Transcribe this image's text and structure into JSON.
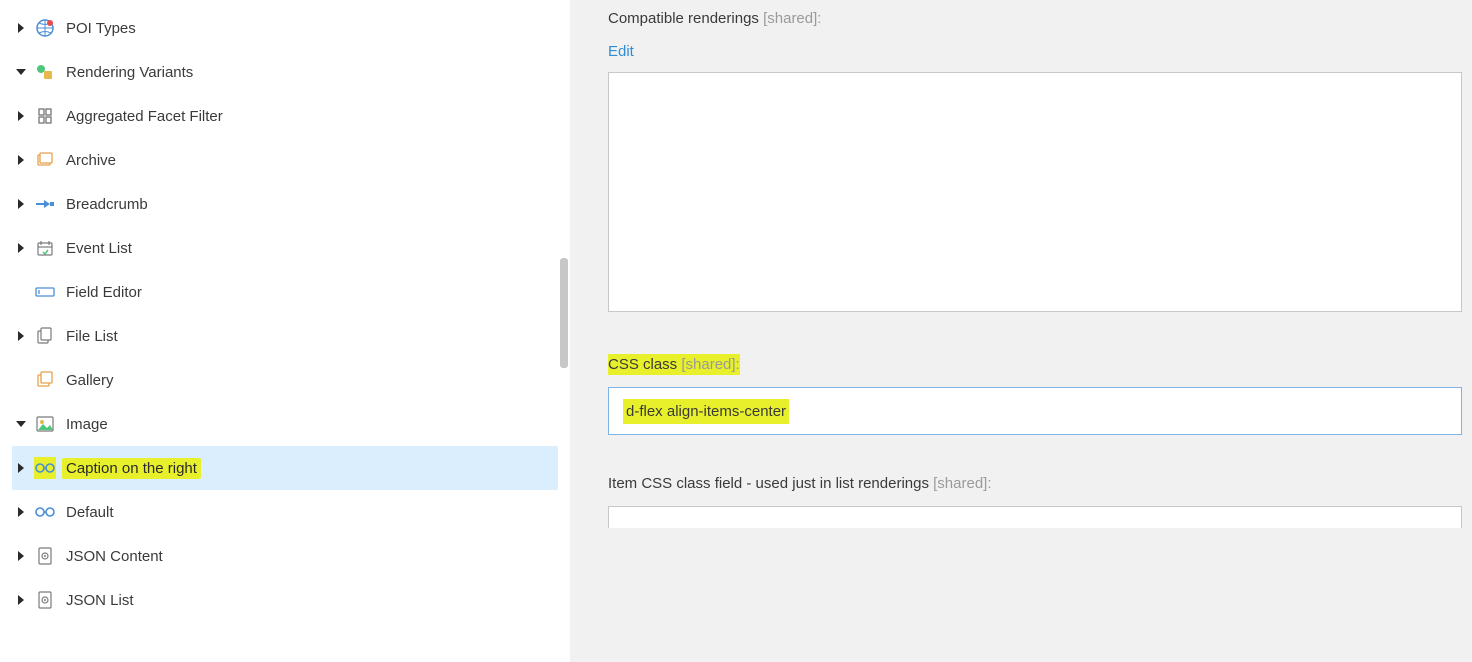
{
  "tree": {
    "poi_types": "POI Types",
    "rendering_variants": "Rendering Variants",
    "aggregated_facet_filter": "Aggregated Facet Filter",
    "archive": "Archive",
    "breadcrumb": "Breadcrumb",
    "event_list": "Event List",
    "field_editor": "Field Editor",
    "file_list": "File List",
    "gallery": "Gallery",
    "image": "Image",
    "caption_on_the_right": "Caption on the right",
    "default": "Default",
    "json_content": "JSON Content",
    "json_list": "JSON List"
  },
  "content": {
    "compatible_renderings_label": "Compatible renderings",
    "shared_suffix": " [shared]:",
    "edit_link": "Edit",
    "compatible_value": "",
    "css_class_label": "CSS class",
    "css_class_value": "d-flex align-items-center",
    "item_css_label": "Item CSS class field - used just in list renderings"
  }
}
